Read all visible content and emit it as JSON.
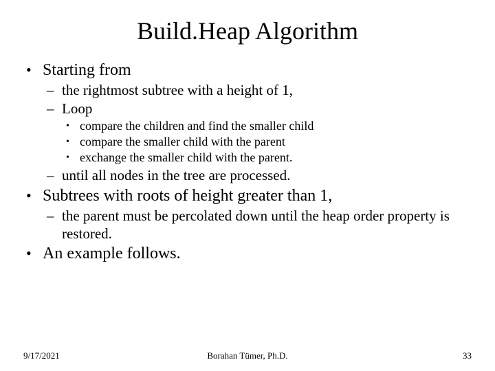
{
  "title": "Build.Heap Algorithm",
  "bullets": {
    "b1": "Starting from",
    "b1a": "the rightmost subtree with a height of 1,",
    "b1b": "Loop",
    "b1b1": "compare the children and find the smaller child",
    "b1b2": "compare the smaller child with the parent",
    "b1b3": "exchange the smaller child with the parent.",
    "b1c": "until all nodes in the tree are processed.",
    "b2": "Subtrees with roots of height greater than 1,",
    "b2a": "the parent must be percolated down until the heap order property is restored.",
    "b3": "An example follows."
  },
  "footer": {
    "date": "9/17/2021",
    "author": "Borahan Tümer, Ph.D.",
    "page": "33"
  }
}
